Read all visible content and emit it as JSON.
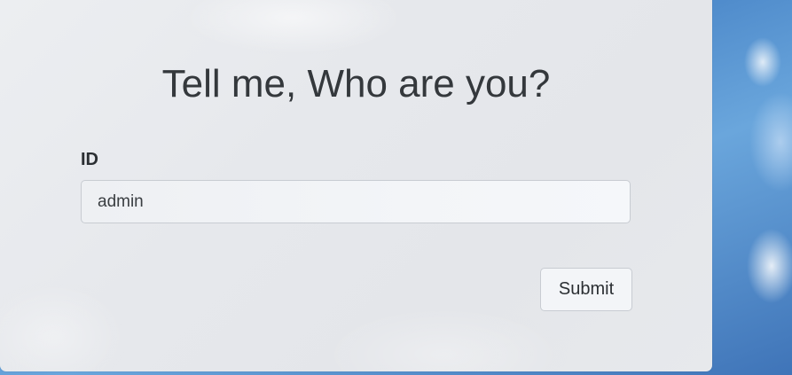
{
  "form": {
    "title": "Tell me, Who are you?",
    "id_label": "ID",
    "id_value": "admin",
    "submit_label": "Submit"
  }
}
